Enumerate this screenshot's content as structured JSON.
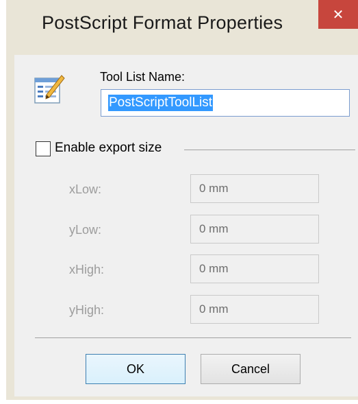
{
  "window": {
    "title": "PostScript Format Properties",
    "close_glyph": "✕"
  },
  "icon": "properties-edit-icon",
  "tool_list": {
    "label": "Tool List Name:",
    "value": "PostScriptToolList",
    "selected": true
  },
  "export": {
    "checkbox_label": "Enable export size",
    "checked": false,
    "fields": [
      {
        "label": "xLow:",
        "value": "0 mm"
      },
      {
        "label": "yLow:",
        "value": "0 mm"
      },
      {
        "label": "xHigh:",
        "value": "0 mm"
      },
      {
        "label": "yHigh:",
        "value": "0 mm"
      }
    ]
  },
  "buttons": {
    "ok": "OK",
    "cancel": "Cancel"
  },
  "colors": {
    "frame": "#e9e5d7",
    "client": "#f0f0f0",
    "close": "#c7463d",
    "selection": "#3399ff",
    "disabled_text": "#9c9c9c"
  }
}
